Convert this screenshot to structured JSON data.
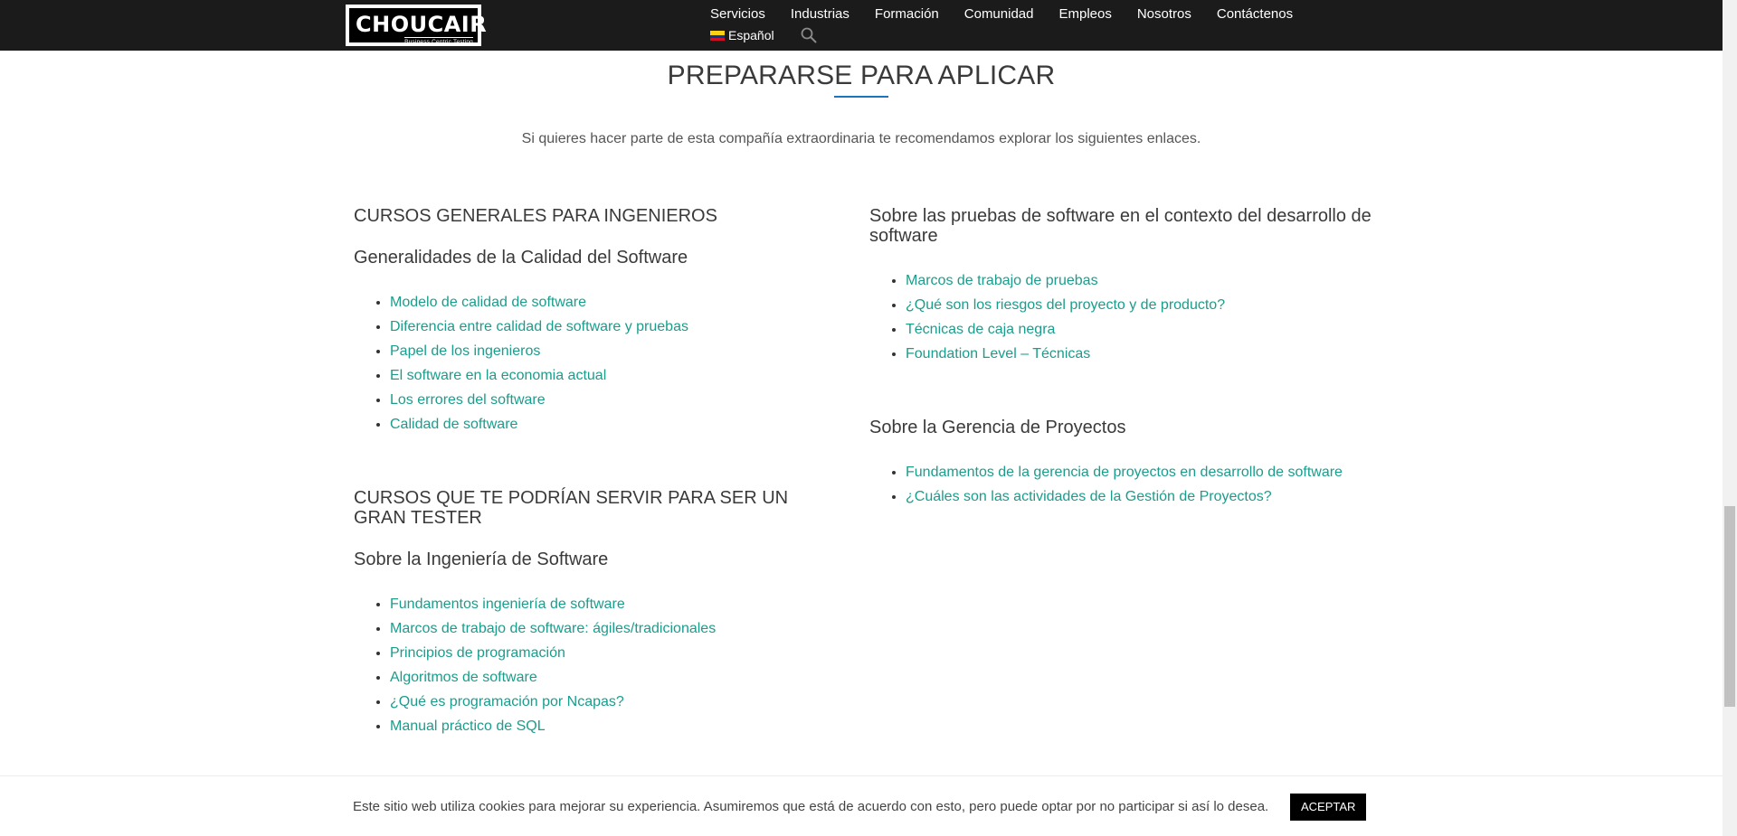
{
  "header": {
    "logo": {
      "word": "CHOUCAIR",
      "tagline": "Business Centric Testing"
    },
    "nav": [
      "Servicios",
      "Industrias",
      "Formación",
      "Comunidad",
      "Empleos",
      "Nosotros",
      "Contáctenos"
    ],
    "language": "Español",
    "icons": {
      "flag": "colombia-flag-icon",
      "search": "search-icon"
    }
  },
  "main": {
    "title": "PREPARARSE PARA APLICAR",
    "intro": "Si quieres hacer parte de esta compañía extraordinaria te recomendamos explorar los siguientes enlaces.",
    "left": {
      "section1": {
        "heading": "CURSOS GENERALES PARA INGENIEROS",
        "subheading": "Generalidades de la Calidad del Software",
        "links": [
          "Modelo de calidad de software",
          "Diferencia entre calidad de software y pruebas",
          "Papel de los ingenieros",
          "El software en la economia actual",
          "Los errores del software",
          "Calidad de software"
        ]
      },
      "section2": {
        "heading": "CURSOS QUE TE PODRÍAN SERVIR PARA SER UN GRAN TESTER",
        "subheading": "Sobre la Ingeniería de Software",
        "links": [
          "Fundamentos ingeniería de software",
          "Marcos de trabajo de software: ágiles/tradicionales",
          "Principios de programación",
          "Algoritmos de software",
          "¿Qué es programación por Ncapas?",
          "Manual práctico de SQL"
        ]
      }
    },
    "right": {
      "section1": {
        "subheading": "Sobre las pruebas de software en el contexto del desarrollo de software",
        "links": [
          "Marcos de trabajo de pruebas",
          "¿Qué son los riesgos del proyecto y de producto?",
          "Técnicas de caja negra",
          "Foundation Level – Técnicas"
        ]
      },
      "section2": {
        "subheading": "Sobre la Gerencia de Proyectos",
        "links": [
          "Fundamentos de la gerencia de proyectos en desarrollo de software",
          "¿Cuáles son las actividades de la Gestión de Proyectos?"
        ]
      }
    }
  },
  "cookie": {
    "text": "Este sitio web utiliza cookies para mejorar su experiencia. Asumiremos que está de acuerdo con esto, pero puede optar por no participar si así lo desea.",
    "button": "ACEPTAR"
  },
  "colors": {
    "header_bg": "#1b1b1b",
    "link": "#1a9d8c",
    "accent": "#1e73be"
  }
}
